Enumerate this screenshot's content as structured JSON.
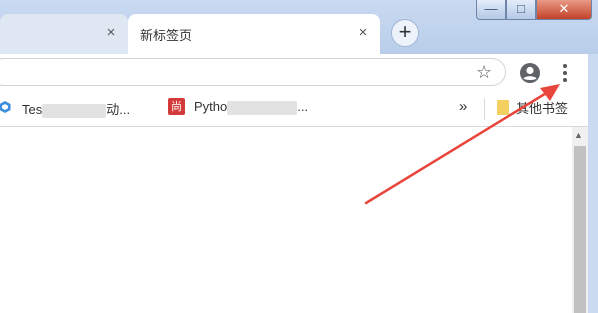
{
  "window": {
    "tabs": [
      {
        "label": "",
        "close_glyph": "×",
        "active": false
      },
      {
        "label": "新标签页",
        "close_glyph": "×",
        "active": true
      }
    ],
    "new_tab_glyph": "+",
    "controls": {
      "minimize": "—",
      "maximize": "□",
      "close": "✕"
    }
  },
  "toolbar": {
    "address_value": "",
    "star_icon": "star-icon",
    "profile_icon": "account-circle-icon",
    "menu_icon": "three-dot-menu-icon"
  },
  "bookmarks": {
    "items": [
      {
        "text_start": "Tes",
        "text_end": "动..."
      },
      {
        "icon_text": "尚",
        "text_start": "Pytho",
        "text_end": "..."
      }
    ],
    "overflow_glyph": "»",
    "other_bookmarks_label": "其他书签"
  },
  "colors": {
    "frame": "#c9daf1",
    "annotation_arrow": "#e8453c",
    "bookmark_icon_red": "#d33a3a",
    "folder_yellow": "#f4d061"
  }
}
